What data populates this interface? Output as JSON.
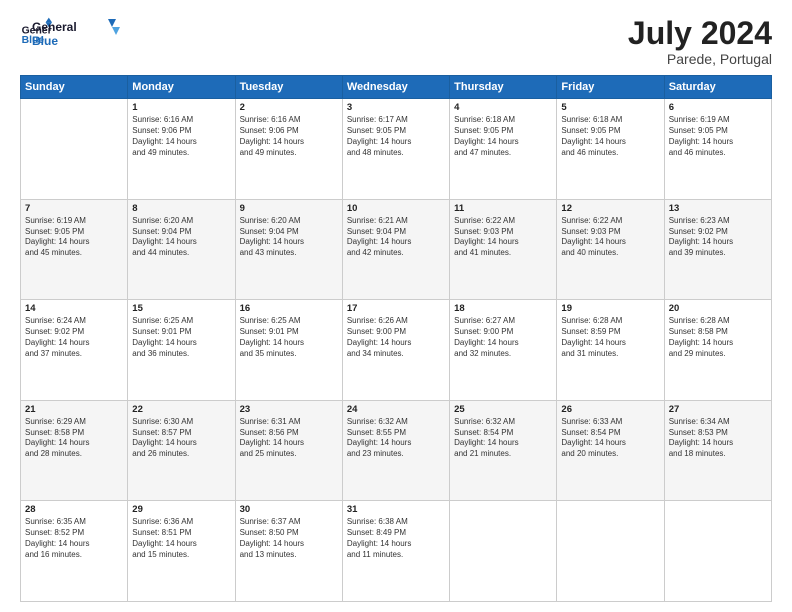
{
  "header": {
    "logo_text_line1": "General",
    "logo_text_line2": "Blue",
    "month": "July 2024",
    "location": "Parede, Portugal"
  },
  "calendar": {
    "days_of_week": [
      "Sunday",
      "Monday",
      "Tuesday",
      "Wednesday",
      "Thursday",
      "Friday",
      "Saturday"
    ],
    "weeks": [
      [
        {
          "day": "",
          "content": ""
        },
        {
          "day": "1",
          "content": "Sunrise: 6:16 AM\nSunset: 9:06 PM\nDaylight: 14 hours\nand 49 minutes."
        },
        {
          "day": "2",
          "content": "Sunrise: 6:16 AM\nSunset: 9:06 PM\nDaylight: 14 hours\nand 49 minutes."
        },
        {
          "day": "3",
          "content": "Sunrise: 6:17 AM\nSunset: 9:05 PM\nDaylight: 14 hours\nand 48 minutes."
        },
        {
          "day": "4",
          "content": "Sunrise: 6:18 AM\nSunset: 9:05 PM\nDaylight: 14 hours\nand 47 minutes."
        },
        {
          "day": "5",
          "content": "Sunrise: 6:18 AM\nSunset: 9:05 PM\nDaylight: 14 hours\nand 46 minutes."
        },
        {
          "day": "6",
          "content": "Sunrise: 6:19 AM\nSunset: 9:05 PM\nDaylight: 14 hours\nand 46 minutes."
        }
      ],
      [
        {
          "day": "7",
          "content": "Sunrise: 6:19 AM\nSunset: 9:05 PM\nDaylight: 14 hours\nand 45 minutes."
        },
        {
          "day": "8",
          "content": "Sunrise: 6:20 AM\nSunset: 9:04 PM\nDaylight: 14 hours\nand 44 minutes."
        },
        {
          "day": "9",
          "content": "Sunrise: 6:20 AM\nSunset: 9:04 PM\nDaylight: 14 hours\nand 43 minutes."
        },
        {
          "day": "10",
          "content": "Sunrise: 6:21 AM\nSunset: 9:04 PM\nDaylight: 14 hours\nand 42 minutes."
        },
        {
          "day": "11",
          "content": "Sunrise: 6:22 AM\nSunset: 9:03 PM\nDaylight: 14 hours\nand 41 minutes."
        },
        {
          "day": "12",
          "content": "Sunrise: 6:22 AM\nSunset: 9:03 PM\nDaylight: 14 hours\nand 40 minutes."
        },
        {
          "day": "13",
          "content": "Sunrise: 6:23 AM\nSunset: 9:02 PM\nDaylight: 14 hours\nand 39 minutes."
        }
      ],
      [
        {
          "day": "14",
          "content": "Sunrise: 6:24 AM\nSunset: 9:02 PM\nDaylight: 14 hours\nand 37 minutes."
        },
        {
          "day": "15",
          "content": "Sunrise: 6:25 AM\nSunset: 9:01 PM\nDaylight: 14 hours\nand 36 minutes."
        },
        {
          "day": "16",
          "content": "Sunrise: 6:25 AM\nSunset: 9:01 PM\nDaylight: 14 hours\nand 35 minutes."
        },
        {
          "day": "17",
          "content": "Sunrise: 6:26 AM\nSunset: 9:00 PM\nDaylight: 14 hours\nand 34 minutes."
        },
        {
          "day": "18",
          "content": "Sunrise: 6:27 AM\nSunset: 9:00 PM\nDaylight: 14 hours\nand 32 minutes."
        },
        {
          "day": "19",
          "content": "Sunrise: 6:28 AM\nSunset: 8:59 PM\nDaylight: 14 hours\nand 31 minutes."
        },
        {
          "day": "20",
          "content": "Sunrise: 6:28 AM\nSunset: 8:58 PM\nDaylight: 14 hours\nand 29 minutes."
        }
      ],
      [
        {
          "day": "21",
          "content": "Sunrise: 6:29 AM\nSunset: 8:58 PM\nDaylight: 14 hours\nand 28 minutes."
        },
        {
          "day": "22",
          "content": "Sunrise: 6:30 AM\nSunset: 8:57 PM\nDaylight: 14 hours\nand 26 minutes."
        },
        {
          "day": "23",
          "content": "Sunrise: 6:31 AM\nSunset: 8:56 PM\nDaylight: 14 hours\nand 25 minutes."
        },
        {
          "day": "24",
          "content": "Sunrise: 6:32 AM\nSunset: 8:55 PM\nDaylight: 14 hours\nand 23 minutes."
        },
        {
          "day": "25",
          "content": "Sunrise: 6:32 AM\nSunset: 8:54 PM\nDaylight: 14 hours\nand 21 minutes."
        },
        {
          "day": "26",
          "content": "Sunrise: 6:33 AM\nSunset: 8:54 PM\nDaylight: 14 hours\nand 20 minutes."
        },
        {
          "day": "27",
          "content": "Sunrise: 6:34 AM\nSunset: 8:53 PM\nDaylight: 14 hours\nand 18 minutes."
        }
      ],
      [
        {
          "day": "28",
          "content": "Sunrise: 6:35 AM\nSunset: 8:52 PM\nDaylight: 14 hours\nand 16 minutes."
        },
        {
          "day": "29",
          "content": "Sunrise: 6:36 AM\nSunset: 8:51 PM\nDaylight: 14 hours\nand 15 minutes."
        },
        {
          "day": "30",
          "content": "Sunrise: 6:37 AM\nSunset: 8:50 PM\nDaylight: 14 hours\nand 13 minutes."
        },
        {
          "day": "31",
          "content": "Sunrise: 6:38 AM\nSunset: 8:49 PM\nDaylight: 14 hours\nand 11 minutes."
        },
        {
          "day": "",
          "content": ""
        },
        {
          "day": "",
          "content": ""
        },
        {
          "day": "",
          "content": ""
        }
      ]
    ]
  }
}
